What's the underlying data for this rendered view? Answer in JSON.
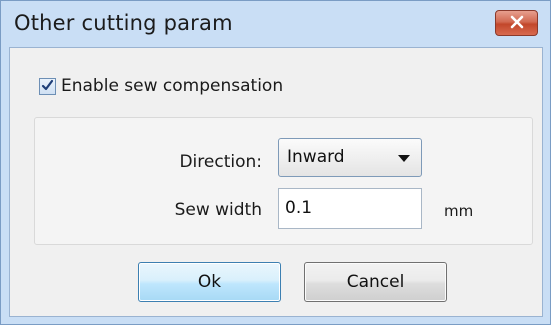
{
  "window": {
    "title": "Other cutting param",
    "close_icon": "close-icon",
    "close_color": "#c9473b"
  },
  "options": {
    "enable_sew_compensation": {
      "label": "Enable sew compensation",
      "checked": true
    }
  },
  "form": {
    "direction": {
      "label": "Direction:",
      "value": "Inward"
    },
    "sew_width": {
      "label": "Sew width",
      "value": "0.1",
      "unit": "mm"
    }
  },
  "buttons": {
    "ok": "Ok",
    "cancel": "Cancel"
  }
}
